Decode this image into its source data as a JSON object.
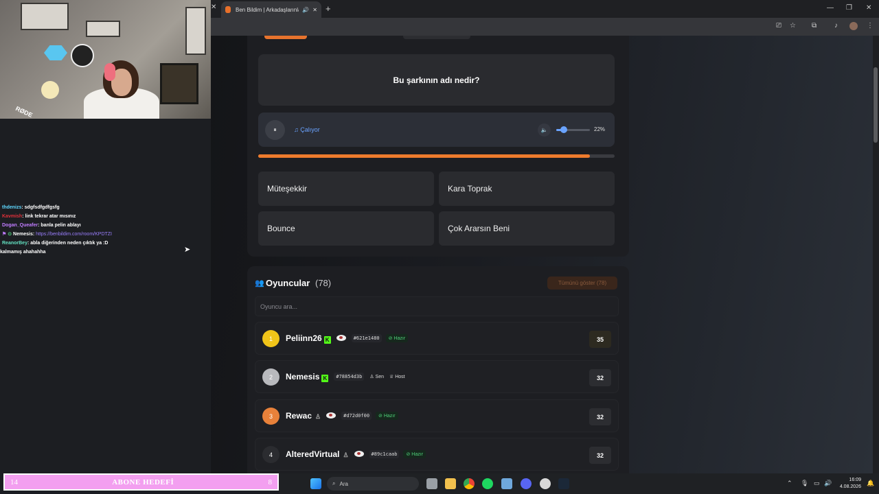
{
  "browser": {
    "tab_title": "Ben Bildim | Arkadaşlarınla",
    "new_tab": "+",
    "tab_close": "✕",
    "minimize": "—",
    "maximize": "❐",
    "close": "✕"
  },
  "game": {
    "question": "Bu şarkının adı nedir?",
    "pause_icon": "⏸",
    "playing_label": "♫ Çalıyor",
    "volume_icon": "🔈",
    "volume_percent": "22%",
    "volume_level": 0.22,
    "progress": 0.93,
    "answers": [
      "Müteşekkir",
      "Kara Toprak",
      "Bounce",
      "Çok Ararsın Beni"
    ]
  },
  "players": {
    "title": "Oyuncular",
    "count": "(78)",
    "show_all": "Tümünü göster (78)",
    "search_placeholder": "Oyuncu ara...",
    "rows": [
      {
        "rank": "1",
        "name": "Peliinn26",
        "hash": "#621e1480",
        "status": "⊘ Hazır",
        "score": "35",
        "rank_color": "#f0c419"
      },
      {
        "rank": "2",
        "name": "Nemesis",
        "hash": "#78854d3b",
        "you": "♙ Sen",
        "host": "♕ Host",
        "score": "32",
        "rank_color": "#b8b9bd"
      },
      {
        "rank": "3",
        "name": "Rewac",
        "hash": "#d72d0f00",
        "status": "⊘ Hazır",
        "score": "32",
        "rank_color": "#e8813a"
      },
      {
        "rank": "4",
        "name": "AlteredVirtual",
        "hash": "#89c1caab",
        "status": "⊘ Hazır",
        "score": "32",
        "rank_color": "#2b2c30"
      }
    ]
  },
  "chat": [
    {
      "user": "thdenizs",
      "color": "#5fd8ff",
      "msg": ": sdgfsdfgdfgsfg"
    },
    {
      "user": "Kavmish",
      "color": "#e0303a",
      "msg": ": link tekrar atar mısınız"
    },
    {
      "user": "Dogan_Queafer",
      "color": "#c07cff",
      "msg": ": banla pelin ablayı"
    },
    {
      "user": "Nemesis",
      "color": "#ffffff",
      "msg": ": ",
      "link": "https://benbildim.com/room/KPDTZI"
    },
    {
      "user": "ReanorBey",
      "color": "#63e0c0",
      "msg": ": abla diğerinden neden çıktık ya :D"
    },
    {
      "user": "",
      "color": "#ffffff",
      "msg": "kalmamış ahahahha"
    }
  ],
  "goal": {
    "left": "14",
    "title": "ABONE HEDEFİ",
    "right": "8"
  },
  "taskbar": {
    "search": "Ara",
    "time": "16:09",
    "date": "4.08.2026"
  }
}
